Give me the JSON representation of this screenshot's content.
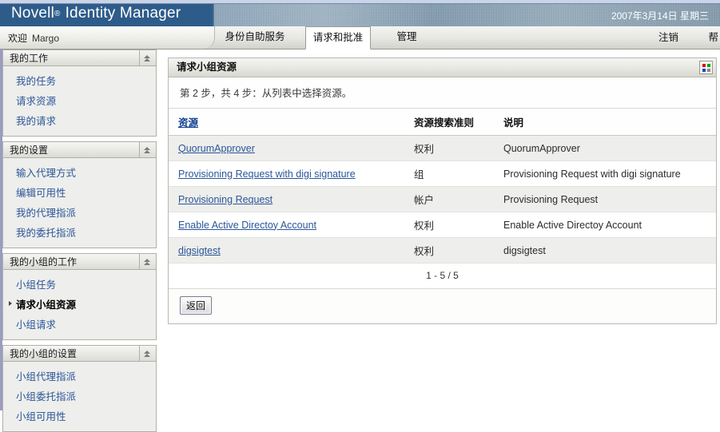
{
  "banner": {
    "brand_novell": "Novell",
    "brand_reg": "®",
    "brand_product": "Identity Manager",
    "date": "2007年3月14日  星期三"
  },
  "navbar": {
    "welcome_label": "欢迎",
    "user_name": "Margo",
    "tabs": [
      {
        "label": "身份自助服务",
        "active": false
      },
      {
        "label": "请求和批准",
        "active": true
      },
      {
        "label": "管理",
        "active": false
      }
    ],
    "logout_label": "注销",
    "help_label": "帮"
  },
  "sidebar": {
    "groups": [
      {
        "title": "我的工作",
        "items": [
          {
            "label": "我的任务",
            "selected": false
          },
          {
            "label": "请求资源",
            "selected": false
          },
          {
            "label": "我的请求",
            "selected": false
          }
        ]
      },
      {
        "title": "我的设置",
        "items": [
          {
            "label": "输入代理方式",
            "selected": false
          },
          {
            "label": "编辑可用性",
            "selected": false
          },
          {
            "label": "我的代理指派",
            "selected": false
          },
          {
            "label": "我的委托指派",
            "selected": false
          }
        ]
      },
      {
        "title": "我的小组的工作",
        "items": [
          {
            "label": "小组任务",
            "selected": false
          },
          {
            "label": "请求小组资源",
            "selected": true
          },
          {
            "label": "小组请求",
            "selected": false
          }
        ]
      },
      {
        "title": "我的小组的设置",
        "items": [
          {
            "label": "小组代理指派",
            "selected": false
          },
          {
            "label": "小组委托指派",
            "selected": false
          },
          {
            "label": "小组可用性",
            "selected": false
          }
        ]
      }
    ]
  },
  "panel": {
    "title": "请求小组资源",
    "step_text": "第 2 步，共 4 步：从列表中选择资源。",
    "columns": [
      {
        "label": "资源",
        "is_link": true
      },
      {
        "label": "资源搜索准则",
        "is_link": false
      },
      {
        "label": "说明",
        "is_link": false
      }
    ],
    "rows": [
      {
        "resource": "QuorumApprover",
        "criteria": "权利",
        "description": "QuorumApprover"
      },
      {
        "resource": "Provisioning Request with digi signature",
        "criteria": "组",
        "description": "Provisioning Request with digi signature"
      },
      {
        "resource": "Provisioning Request",
        "criteria": "帐户",
        "description": "Provisioning Request"
      },
      {
        "resource": "Enable Active Directoy Account",
        "criteria": "权利",
        "description": "Enable Active Directoy Account"
      },
      {
        "resource": "digsigtest",
        "criteria": "权利",
        "description": "digsigtest"
      }
    ],
    "pager_text": "1 - 5 / 5",
    "back_button": "返回"
  },
  "colors": {
    "banner_blue": "#2e5c8a",
    "link_blue": "#2a5699",
    "header_link_blue": "#12418f",
    "row_alt": "#eeeeec",
    "sidebar_border": "#9b9bc4"
  }
}
